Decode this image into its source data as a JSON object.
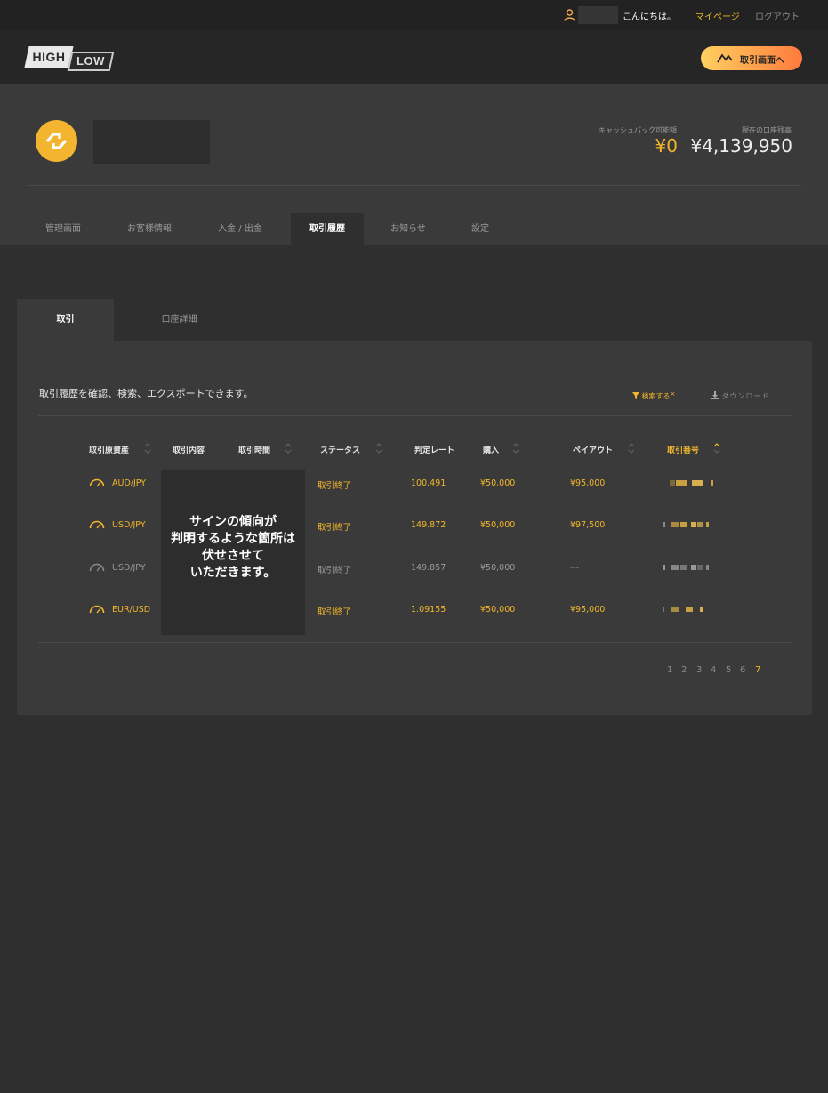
{
  "topbar": {
    "greeting": "こんにちは。",
    "mypage": "マイページ",
    "logout": "ログアウト"
  },
  "header": {
    "logo_high": "HIGH",
    "logo_low": "LOW",
    "trade_button": "取引画面へ"
  },
  "account": {
    "cashback_label": "キャッシュバック可能額",
    "cashback_value": "¥0",
    "balance_label": "現在の口座残高",
    "balance_value": "¥4,139,950",
    "tabs": [
      {
        "label": "管理画面",
        "active": false
      },
      {
        "label": "お客様情報",
        "active": false
      },
      {
        "label": "入金 / 出金",
        "active": false
      },
      {
        "label": "取引履歴",
        "active": true
      },
      {
        "label": "お知らせ",
        "active": false
      },
      {
        "label": "設定",
        "active": false
      }
    ]
  },
  "panel": {
    "subtabs": [
      "取引",
      "口座詳細"
    ],
    "intro": "取引履歴を確認、検索、エクスポートできます。",
    "search": "検索する",
    "search_close": "×",
    "download": "ダウンロード",
    "headers": [
      "取引原資産",
      "取引内容",
      "取引時間",
      "ステータス",
      "判定レート",
      "購入",
      "ペイアウト",
      "取引番号"
    ],
    "redaction_note": [
      "サインの傾向が",
      "判明するような箇所は",
      "伏せさせて",
      "いただきます。"
    ],
    "rows": [
      {
        "asset": "AUD/JPY",
        "status": "取引終了",
        "rate": "100.491",
        "purchase": "¥50,000",
        "payout": "¥95,000",
        "win": true
      },
      {
        "asset": "USD/JPY",
        "status": "取引終了",
        "rate": "149.872",
        "purchase": "¥50,000",
        "payout": "¥97,500",
        "win": true
      },
      {
        "asset": "USD/JPY",
        "status": "取引終了",
        "rate": "149.857",
        "purchase": "¥50,000",
        "payout": "---",
        "win": false
      },
      {
        "asset": "EUR/USD",
        "status": "取引終了",
        "rate": "1.09155",
        "purchase": "¥50,000",
        "payout": "¥95,000",
        "win": true
      }
    ],
    "pagination": [
      "1",
      "2",
      "3",
      "4",
      "5",
      "6",
      "7"
    ],
    "current_page": "7"
  },
  "colors": {
    "accent": "#f2b62b",
    "background": "#2f2f2f",
    "panel": "#3a3a3a"
  }
}
